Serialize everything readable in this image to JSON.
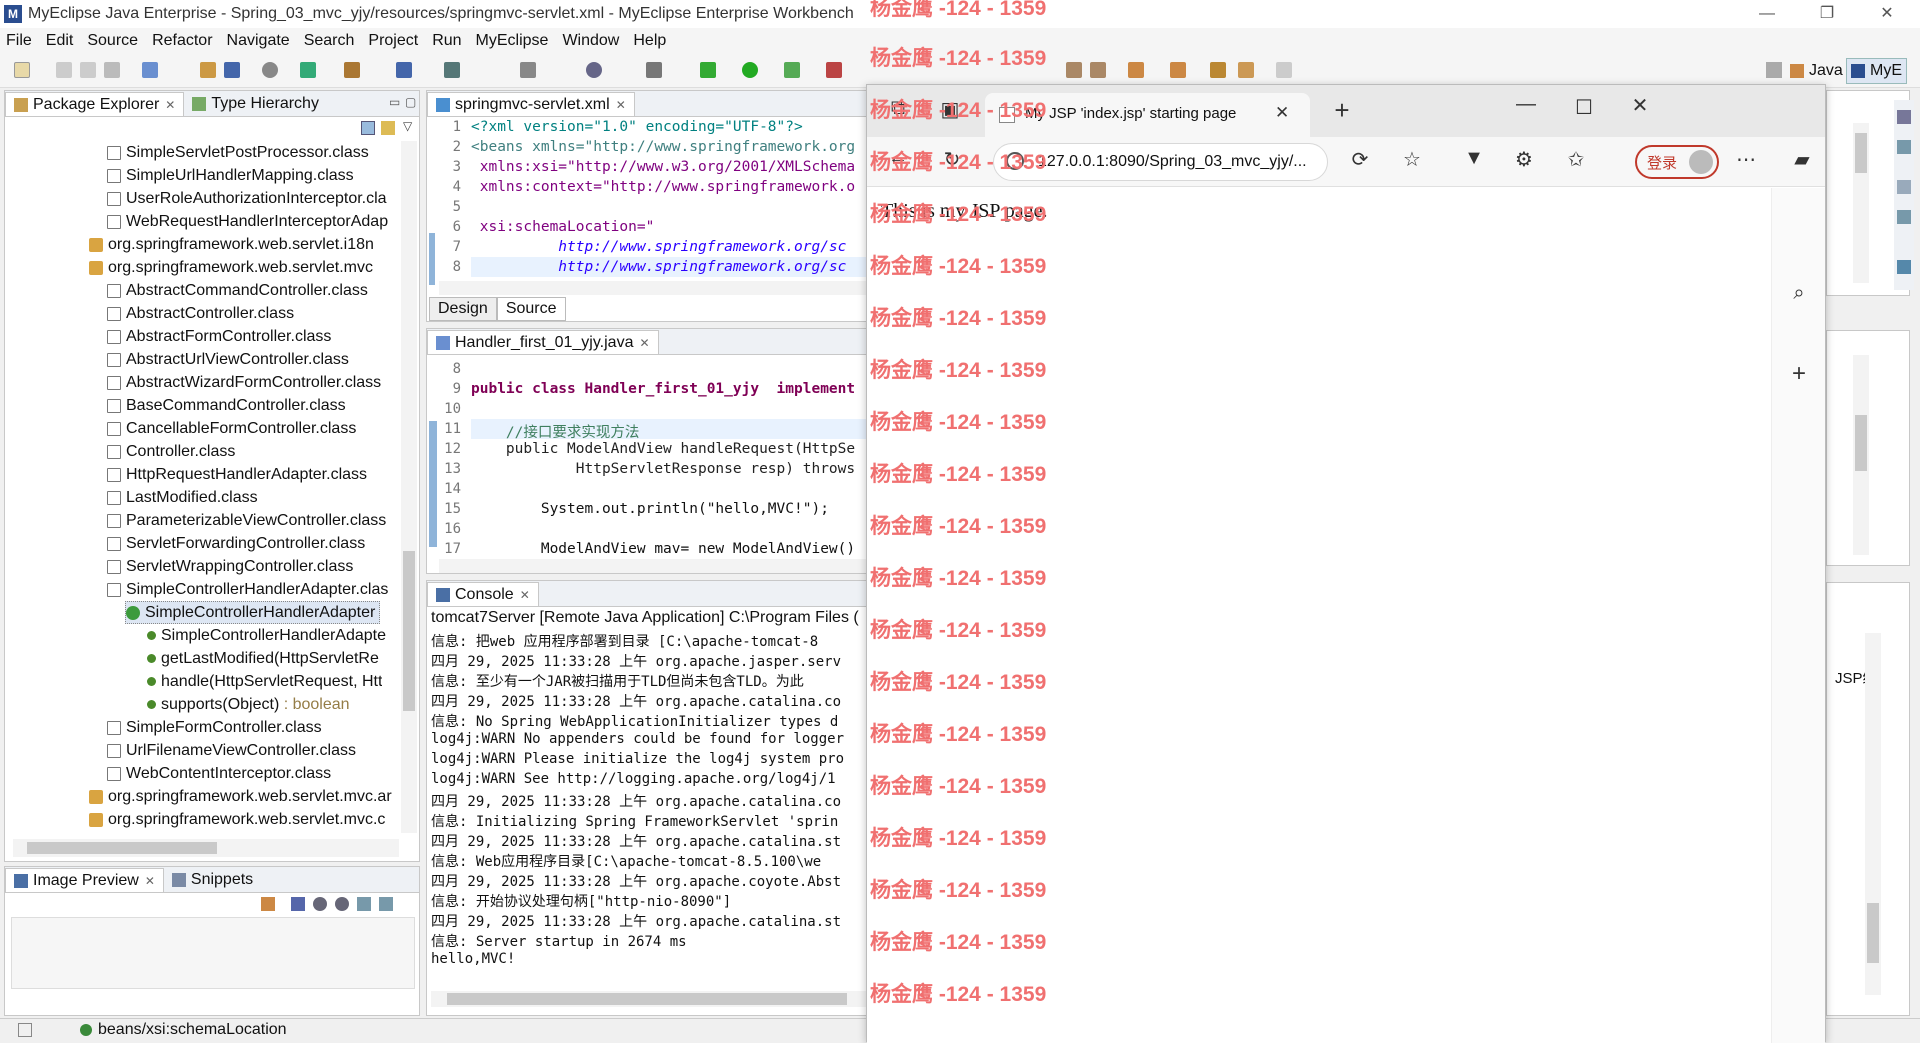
{
  "window": {
    "title": "MyEclipse Java Enterprise - Spring_03_mvc_yjy/resources/springmvc-servlet.xml - MyEclipse Enterprise Workbench",
    "controls": {
      "minimize": "—",
      "maximize": "❐",
      "close": "✕"
    }
  },
  "menu": [
    "File",
    "Edit",
    "Source",
    "Refactor",
    "Navigate",
    "Search",
    "Project",
    "Run",
    "MyEclipse",
    "Window",
    "Help"
  ],
  "perspectives": {
    "java": "Java",
    "myeclipse": "MyE"
  },
  "package_explorer": {
    "tabs": [
      "Package Explorer",
      "Type Hierarchy"
    ],
    "items": [
      "SimpleServletPostProcessor.class",
      "SimpleUrlHandlerMapping.class",
      "UserRoleAuthorizationInterceptor.cla",
      "WebRequestHandlerInterceptorAdap",
      "org.springframework.web.servlet.i18n",
      "org.springframework.web.servlet.mvc",
      "AbstractCommandController.class",
      "AbstractController.class",
      "AbstractFormController.class",
      "AbstractUrlViewController.class",
      "AbstractWizardFormController.class",
      "BaseCommandController.class",
      "CancellableFormController.class",
      "Controller.class",
      "HttpRequestHandlerAdapter.class",
      "LastModified.class",
      "ParameterizableViewController.class",
      "ServletForwardingController.class",
      "ServletWrappingController.class",
      "SimpleControllerHandlerAdapter.clas",
      "SimpleControllerHandlerAdapter",
      "SimpleControllerHandlerAdapte",
      "getLastModified(HttpServletRe",
      "handle(HttpServletRequest, Htt",
      "supports(Object)",
      "SimpleFormController.class",
      "UrlFilenameViewController.class",
      "WebContentInterceptor.class",
      "org.springframework.web.servlet.mvc.ar",
      "org.springframework.web.servlet.mvc.c"
    ],
    "supports_return": ": boolean"
  },
  "image_preview": {
    "tabs": [
      "Image Preview",
      "Snippets"
    ]
  },
  "status_bar": {
    "text": "beans/xsi:schemaLocation"
  },
  "xml_editor": {
    "tab": "springmvc-servlet.xml",
    "bottom_tabs": [
      "Design",
      "Source"
    ],
    "line_numbers": [
      "1",
      "2",
      "3",
      "4",
      "5",
      "6",
      "7",
      "8"
    ],
    "lines": [
      "<?xml version=\"1.0\" encoding=\"UTF-8\"?>",
      "<beans xmlns=\"http://www.springframework.org",
      " xmlns:xsi=\"http://www.w3.org/2001/XMLSchema",
      " xmlns:context=\"http://www.springframework.o",
      "",
      " xsi:schemaLocation=\"",
      "          http://www.springframework.org/sc",
      "          http://www.springframework.org/sc"
    ]
  },
  "java_editor": {
    "tab": "Handler_first_01_yjy.java",
    "line_numbers": [
      "8",
      "9",
      "10",
      "11",
      "12",
      "13",
      "14",
      "15",
      "16",
      "17"
    ],
    "lines": [
      "",
      "public class Handler_first_01_yjy  implement",
      "",
      "    //接口要求实现方法",
      "    public ModelAndView handleRequest(HttpSe",
      "            HttpServletResponse resp) throws",
      "",
      "        System.out.println(\"hello,MVC!\");",
      "",
      "        ModelAndView mav= new ModelAndView()"
    ]
  },
  "console": {
    "tab": "Console",
    "header": "tomcat7Server [Remote Java Application] C:\\Program Files (",
    "lines": [
      "信息: 把web 应用程序部署到目录 [C:\\apache-tomcat-8",
      "四月 29, 2025 11:33:28 上午 org.apache.jasper.serv",
      "信息: 至少有一个JAR被扫描用于TLD但尚未包含TLD。为此",
      "四月 29, 2025 11:33:28 上午 org.apache.catalina.co",
      "信息: No Spring WebApplicationInitializer types d",
      "log4j:WARN No appenders could be found for logger",
      "log4j:WARN Please initialize the log4j system pro",
      "log4j:WARN See http://logging.apache.org/log4j/1",
      "四月 29, 2025 11:33:28 上午 org.apache.catalina.co",
      "信息: Initializing Spring FrameworkServlet 'sprin",
      "四月 29, 2025 11:33:28 上午 org.apache.catalina.st",
      "信息: Web应用程序目录[C:\\apache-tomcat-8.5.100\\we",
      "四月 29, 2025 11:33:28 上午 org.apache.coyote.Abst",
      "信息: 开始协议处理句柄[\"http-nio-8090\"]",
      "四月 29, 2025 11:33:28 上午 org.apache.catalina.st",
      "信息: Server startup in 2674 ms",
      "hello,MVC!"
    ],
    "right_fragment": "JSP编"
  },
  "browser": {
    "tab_title": "My JSP 'index.jsp' starting page",
    "url": "127.0.0.1:8090/Spring_03_mvc_yjy/...",
    "login": "登录",
    "page_text": "This is my JSP page."
  },
  "watermark": {
    "text": "杨金鹰 -124 - 1359",
    "color": "#f07070"
  }
}
